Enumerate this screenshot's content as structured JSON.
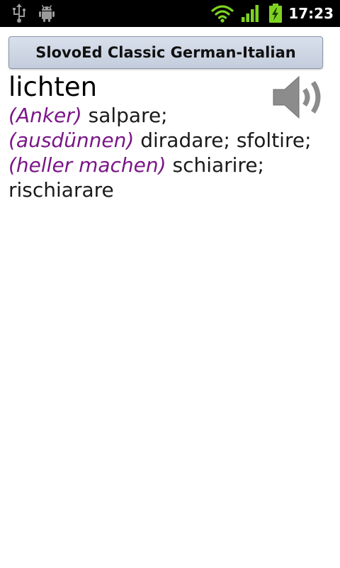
{
  "status_bar": {
    "time": "17:23",
    "icons": [
      "usb-icon",
      "android-debug-icon",
      "wifi-icon",
      "signal-icon",
      "battery-charging-icon"
    ]
  },
  "app": {
    "title": "SlovoEd Classic German-Italian"
  },
  "entry": {
    "headword": "lichten",
    "speaker_icon": "speaker-icon",
    "senses": [
      {
        "label": "(Anker)",
        "translation": " salpare;"
      },
      {
        "label": "(ausdünnen)",
        "translation": " diradare; sfoltire;"
      },
      {
        "label": "(heller machen)",
        "translation": " schiarire; rischiarare"
      }
    ]
  },
  "colors": {
    "status_bar_bg": "#000000",
    "status_icons_green": "#7ed321",
    "title_bar_bg": "#cdd5e3",
    "sense_label": "#7a1687",
    "speaker_gray": "#8c8c8c"
  }
}
